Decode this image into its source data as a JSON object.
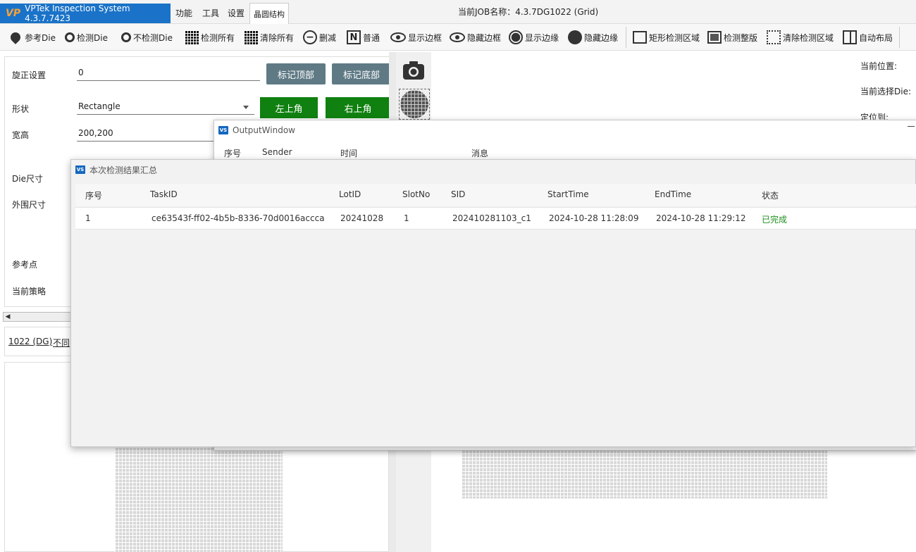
{
  "app": {
    "title": "VPTek Inspection System 4.3.7.7423",
    "logo": "VP",
    "job_label": "当前JOB名称：4.3.7DG1022 (Grid)"
  },
  "menu": {
    "items": [
      "功能",
      "工具",
      "设置"
    ],
    "active_tab": "晶圆结构"
  },
  "toolbar": {
    "buttons": [
      {
        "label": "参考Die",
        "icon": "pin-icon"
      },
      {
        "label": "检测Die",
        "icon": "search-pin-icon"
      },
      {
        "label": "不检测Die",
        "icon": "search-pin-icon"
      },
      {
        "label": "检测所有",
        "icon": "grid-icon"
      },
      {
        "label": "清除所有",
        "icon": "grid-icon"
      },
      {
        "label": "删减",
        "icon": "minus-circle-icon"
      },
      {
        "label": "普通",
        "icon": "n-box-icon"
      },
      {
        "label": "显示边框",
        "icon": "eye-icon"
      },
      {
        "label": "隐藏边框",
        "icon": "eye-hidden-icon"
      },
      {
        "label": "显示边缘",
        "icon": "ring-dot-icon"
      },
      {
        "label": "隐藏边缘",
        "icon": "dot-icon"
      },
      {
        "label": "矩形检测区域",
        "icon": "rect-icon"
      },
      {
        "label": "检测整版",
        "icon": "rect-fill-icon"
      },
      {
        "label": "清除检测区域",
        "icon": "dotted-rect-icon"
      },
      {
        "label": "自动布局",
        "icon": "layout-icon"
      }
    ]
  },
  "left_panel": {
    "rotation_label": "旋正设置",
    "rotation_value": "0",
    "mark_top_btn": "标记顶部",
    "mark_bottom_btn": "标记底部",
    "shape_label": "形状",
    "shape_value": "Rectangle",
    "top_left_btn": "左上角",
    "top_right_btn": "右上角",
    "size_label": "宽高",
    "size_value": "200,200",
    "die_size_label": "Die尺寸",
    "outer_size_label": "外围尺寸",
    "ref_point_label": "参考点",
    "strategy_label": "当前策略"
  },
  "job_strip": {
    "link1": "1022 (DG)",
    "link2": "不同"
  },
  "right_info": {
    "current_pos": "当前位置:",
    "current_die": "当前选择Die:",
    "locate_to": "定位到:"
  },
  "output_window": {
    "title": "OutputWindow",
    "icon": "VS",
    "columns": [
      "序号",
      "Sender",
      "时间",
      "消息"
    ]
  },
  "summary_window": {
    "title": "本次检测结果汇总",
    "icon": "VS",
    "columns": [
      "序号",
      "TaskID",
      "LotID",
      "SlotNo",
      "SID",
      "StartTime",
      "EndTime",
      "状态"
    ],
    "rows": [
      [
        "1",
        "ce63543f-ff02-4b5b-8336-70d0016accca",
        "20241028",
        "1",
        "202410281103_c1",
        "2024-10-28 11:28:09",
        "2024-10-28 11:29:12",
        "已完成"
      ]
    ]
  },
  "colors": {
    "title_blue": "#1a73c8",
    "btn_gray": "#5f7a85",
    "btn_green": "#108010",
    "status_green": "#1f8f1f"
  }
}
